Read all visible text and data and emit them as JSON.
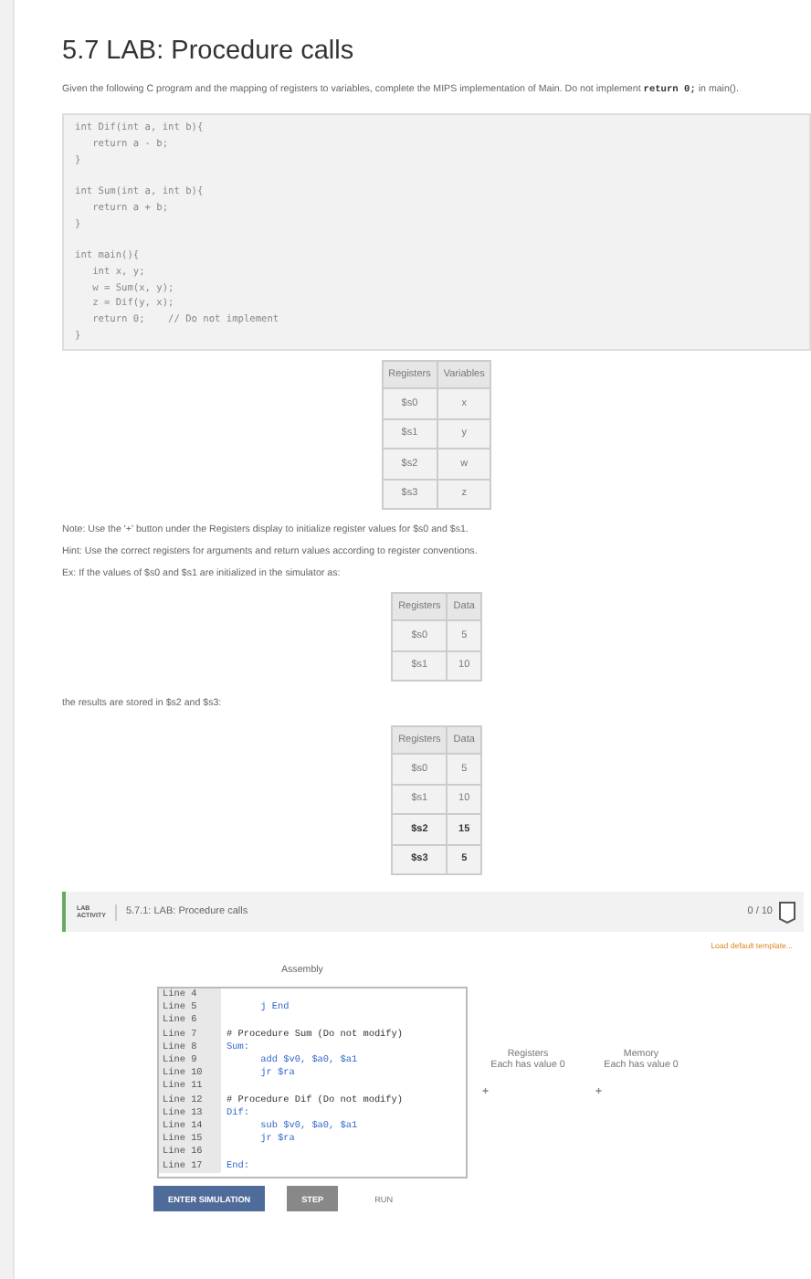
{
  "title": "5.7 LAB: Procedure calls",
  "description": {
    "text": "Given the following C program and the mapping of registers to variables, complete the MIPS implementation of Main. Do not implement",
    "code": "return 0;",
    "suffix": "in main()."
  },
  "code_block": [
    [
      "int Dif(int a, int b){",
      "   return a - b;",
      "}"
    ],
    [
      "int Sum(int a, int b){",
      "   return a + b;",
      "}"
    ],
    [
      "int main(){",
      "   int x, y;",
      "   w = Sum(x, y);",
      "   z = Dif(y, x);",
      "   return 0;    // Do not implement",
      "}"
    ]
  ],
  "mapping_table": {
    "columns": [
      "Registers",
      "Variables"
    ],
    "rows": [
      {
        "cells": [
          "$s0",
          "x"
        ],
        "highlighted": false
      },
      {
        "cells": [
          "$s1",
          "y"
        ],
        "highlighted": false
      },
      {
        "cells": [
          "$s2",
          "w"
        ],
        "highlighted": false
      },
      {
        "cells": [
          "$s3",
          "z"
        ],
        "highlighted": false
      }
    ]
  },
  "notes": [
    "Note: Use the '+' button under the Registers display to initialize register values for $s0 and $s1.",
    "Hint: Use the correct registers for arguments and return values according to register conventions.",
    "Ex: If the values of $s0 and $s1 are initialized in the simulator as:"
  ],
  "input_table": {
    "columns": [
      "Registers",
      "Data"
    ],
    "rows": [
      {
        "cells": [
          "$s0",
          "5"
        ],
        "highlighted": false
      },
      {
        "cells": [
          "$s1",
          "10"
        ],
        "highlighted": false
      }
    ]
  },
  "results_text": "the results are stored in $s2 and $s3:",
  "result_table": {
    "columns": [
      "Registers",
      "Data"
    ],
    "rows": [
      {
        "cells": [
          "$s0",
          "5"
        ],
        "highlighted": false
      },
      {
        "cells": [
          "$s1",
          "10"
        ],
        "highlighted": false
      },
      {
        "cells": [
          "$s2",
          "15"
        ],
        "highlighted": true
      },
      {
        "cells": [
          "$s3",
          "5"
        ],
        "highlighted": true
      }
    ]
  },
  "lab_activity": {
    "badge": [
      "LAB",
      "ACTIVITY"
    ],
    "title": "5.7.1: LAB: Procedure calls",
    "score": "0 / 10"
  },
  "load_template": "Load default template...",
  "editor": {
    "heading": "Assembly",
    "lines": [
      {
        "number": "Line 4",
        "kind": "blank"
      },
      {
        "number": "Line 5",
        "code": "      j End",
        "kind": "instruction"
      },
      {
        "number": "Line 6",
        "kind": "blank"
      },
      {
        "number": "Line 7",
        "code": "# Procedure Sum (Do not modify)",
        "kind": "comment"
      },
      {
        "number": "Line 8",
        "code": "Sum:",
        "kind": "label"
      },
      {
        "number": "Line 9",
        "code": "      add $v0, $a0, $a1",
        "kind": "instruction"
      },
      {
        "number": "Line 10",
        "code": "      jr $ra",
        "kind": "instruction"
      },
      {
        "number": "Line 11",
        "kind": "blank"
      },
      {
        "number": "Line 12",
        "code": "# Procedure Dif (Do not modify)",
        "kind": "comment"
      },
      {
        "number": "Line 13",
        "code": "Dif:",
        "kind": "label"
      },
      {
        "number": "Line 14",
        "code": "      sub $v0, $a0, $a1",
        "kind": "instruction"
      },
      {
        "number": "Line 15",
        "code": "      jr $ra",
        "kind": "instruction"
      },
      {
        "number": "Line 16",
        "kind": "blank"
      },
      {
        "number": "Line 17",
        "code": "End:",
        "kind": "label"
      }
    ]
  },
  "panels": [
    {
      "title": "Registers",
      "note": "Each has value 0",
      "add": "+"
    },
    {
      "title": "Memory",
      "note": "Each has value 0",
      "add": "+"
    }
  ],
  "buttons": [
    {
      "label": "ENTER SIMULATION",
      "kind": "primary"
    },
    {
      "label": "STEP",
      "kind": "secondary"
    },
    {
      "label": "RUN",
      "kind": "plain"
    }
  ]
}
